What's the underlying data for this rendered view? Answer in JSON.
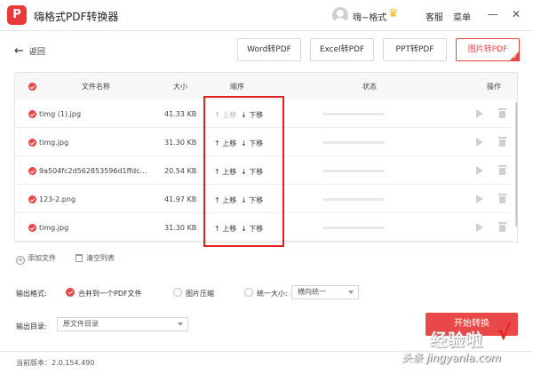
{
  "app": {
    "logo_text": "P",
    "title": "嗨格式PDF转换器",
    "username": "嗨~格式",
    "service_label": "客服",
    "menu_label": "菜单",
    "minimize_glyph": "—",
    "close_glyph": "✕"
  },
  "toolbar": {
    "back_label": "返回",
    "modes": [
      {
        "label": "Word转PDF",
        "active": false
      },
      {
        "label": "Excel转PDF",
        "active": false
      },
      {
        "label": "PPT转PDF",
        "active": false
      },
      {
        "label": "图片转PDF",
        "active": true
      }
    ]
  },
  "table": {
    "headers": {
      "name": "文件名称",
      "size": "大小",
      "order": "顺序",
      "status": "状态",
      "action": "操作"
    },
    "move_up": "上移",
    "move_down": "下移",
    "rows": [
      {
        "name": "timg (1).jpg",
        "size": "41.33 KB"
      },
      {
        "name": "timg.jpg",
        "size": "31.30 KB"
      },
      {
        "name": "9a504fc2d562853596d1ffdc...",
        "size": "20.54 KB"
      },
      {
        "name": "123-2.png",
        "size": "41.97 KB"
      },
      {
        "name": "timg.jpg",
        "size": "31.30 KB"
      }
    ]
  },
  "list_actions": {
    "add_file": "添加文件",
    "clear_list": "清空列表"
  },
  "output": {
    "format_label": "输出格式:",
    "merge_option": "合并到一个PDF文件",
    "compress_option": "图片压缩",
    "unify_size_option": "统一大小:",
    "unify_size_value": "横向统一",
    "dir_label": "输出目录:",
    "dir_value": "原文件目录",
    "start_button": "开始转换"
  },
  "footer": {
    "version": "当前版本：2.0.154.490"
  },
  "watermark": {
    "line1": "经验啦",
    "line2": "头条 jingyanla.com",
    "check": "√"
  },
  "colors": {
    "accent": "#e84545",
    "highlight_box": "#e02020"
  }
}
